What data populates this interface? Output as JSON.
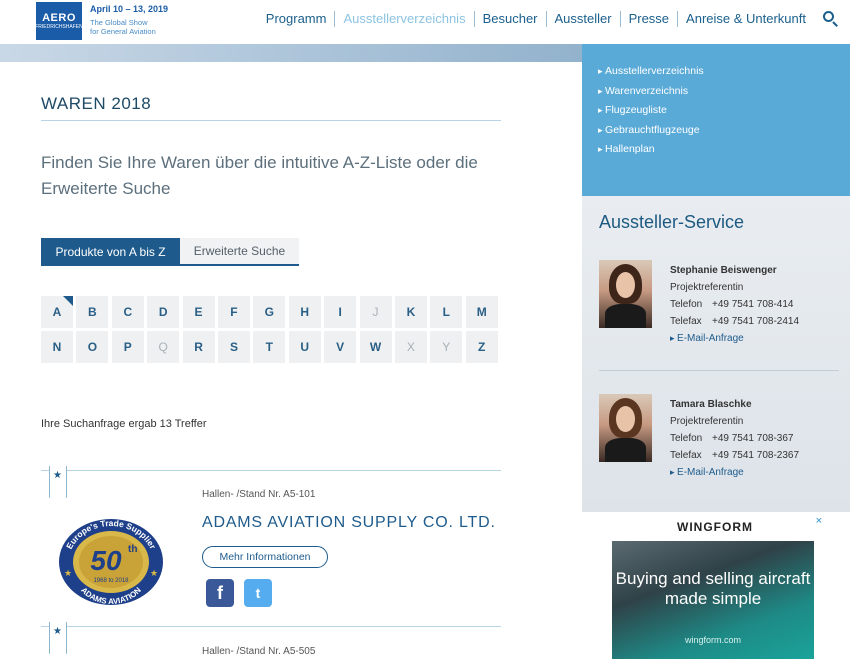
{
  "header": {
    "logo_text": "AERO",
    "logo_sub": "FRIEDRICHSHAFEN",
    "date": "April 10 – 13, 2019",
    "tagline_1": "The Global Show",
    "tagline_2": "for General Aviation",
    "nav": [
      "Programm",
      "Ausstellerverzeichnis",
      "Besucher",
      "Aussteller",
      "Presse",
      "Anreise & Unterkunft"
    ],
    "active_nav": "Ausstellerverzeichnis"
  },
  "main": {
    "title": "WAREN 2018",
    "intro": "Finden Sie Ihre Waren über die intuitive A-Z-Liste oder die Erweiterte Suche",
    "tabs": [
      "Produkte von A bis Z",
      "Erweiterte Suche"
    ],
    "letters": [
      {
        "l": "A",
        "enabled": true,
        "selected": true
      },
      {
        "l": "B",
        "enabled": true
      },
      {
        "l": "C",
        "enabled": true
      },
      {
        "l": "D",
        "enabled": true
      },
      {
        "l": "E",
        "enabled": true
      },
      {
        "l": "F",
        "enabled": true
      },
      {
        "l": "G",
        "enabled": true
      },
      {
        "l": "H",
        "enabled": true
      },
      {
        "l": "I",
        "enabled": true
      },
      {
        "l": "J",
        "enabled": false
      },
      {
        "l": "K",
        "enabled": true
      },
      {
        "l": "L",
        "enabled": true
      },
      {
        "l": "M",
        "enabled": true
      },
      {
        "l": "N",
        "enabled": true
      },
      {
        "l": "O",
        "enabled": true
      },
      {
        "l": "P",
        "enabled": true
      },
      {
        "l": "Q",
        "enabled": false
      },
      {
        "l": "R",
        "enabled": true
      },
      {
        "l": "S",
        "enabled": true
      },
      {
        "l": "T",
        "enabled": true
      },
      {
        "l": "U",
        "enabled": true
      },
      {
        "l": "V",
        "enabled": true
      },
      {
        "l": "W",
        "enabled": true
      },
      {
        "l": "X",
        "enabled": false
      },
      {
        "l": "Y",
        "enabled": false
      },
      {
        "l": "Z",
        "enabled": true
      }
    ],
    "result_count": "Ihre Suchanfrage ergab 13 Treffer",
    "entries": [
      {
        "stand": "Hallen- /Stand Nr. A5-101",
        "company": "ADAMS AVIATION SUPPLY CO. LTD.",
        "more_label": "Mehr Informationen",
        "badge_top": "Europe's Trade Supplier",
        "badge_number": "50",
        "badge_suffix": "th",
        "badge_years": "1968 to 2018",
        "badge_bottom": "ADAMS AVIATION"
      },
      {
        "stand": "Hallen- /Stand Nr. A5-505"
      }
    ],
    "bookmark_glyph": "★"
  },
  "sidebar": {
    "links": [
      "Ausstellerverzeichnis",
      "Warenverzeichnis",
      "Flugzeugliste",
      "Gebrauchtflugzeuge",
      "Hallenplan"
    ],
    "service_title": "Aussteller-Service",
    "people": [
      {
        "name": "Stephanie Beiswenger",
        "role": "Projektreferentin",
        "phone_label": "Telefon",
        "phone": "+49 7541 708-414",
        "fax_label": "Telefax",
        "fax": "+49 7541 708-2414",
        "mail": "E-Mail-Anfrage"
      },
      {
        "name": "Tamara Blaschke",
        "role": "Projektreferentin",
        "phone_label": "Telefon",
        "phone": "+49 7541 708-367",
        "fax_label": "Telefax",
        "fax": "+49 7541 708-2367",
        "mail": "E-Mail-Anfrage"
      }
    ]
  },
  "ad": {
    "brand": "WINGFORM",
    "close": "×",
    "headline": "Buying and selling aircraft made simple",
    "url": "wingform.com"
  },
  "colors": {
    "brand_blue": "#1e5b8c",
    "sidebar_blue": "#5aaad8",
    "active_nav": "#8cc4e2"
  }
}
